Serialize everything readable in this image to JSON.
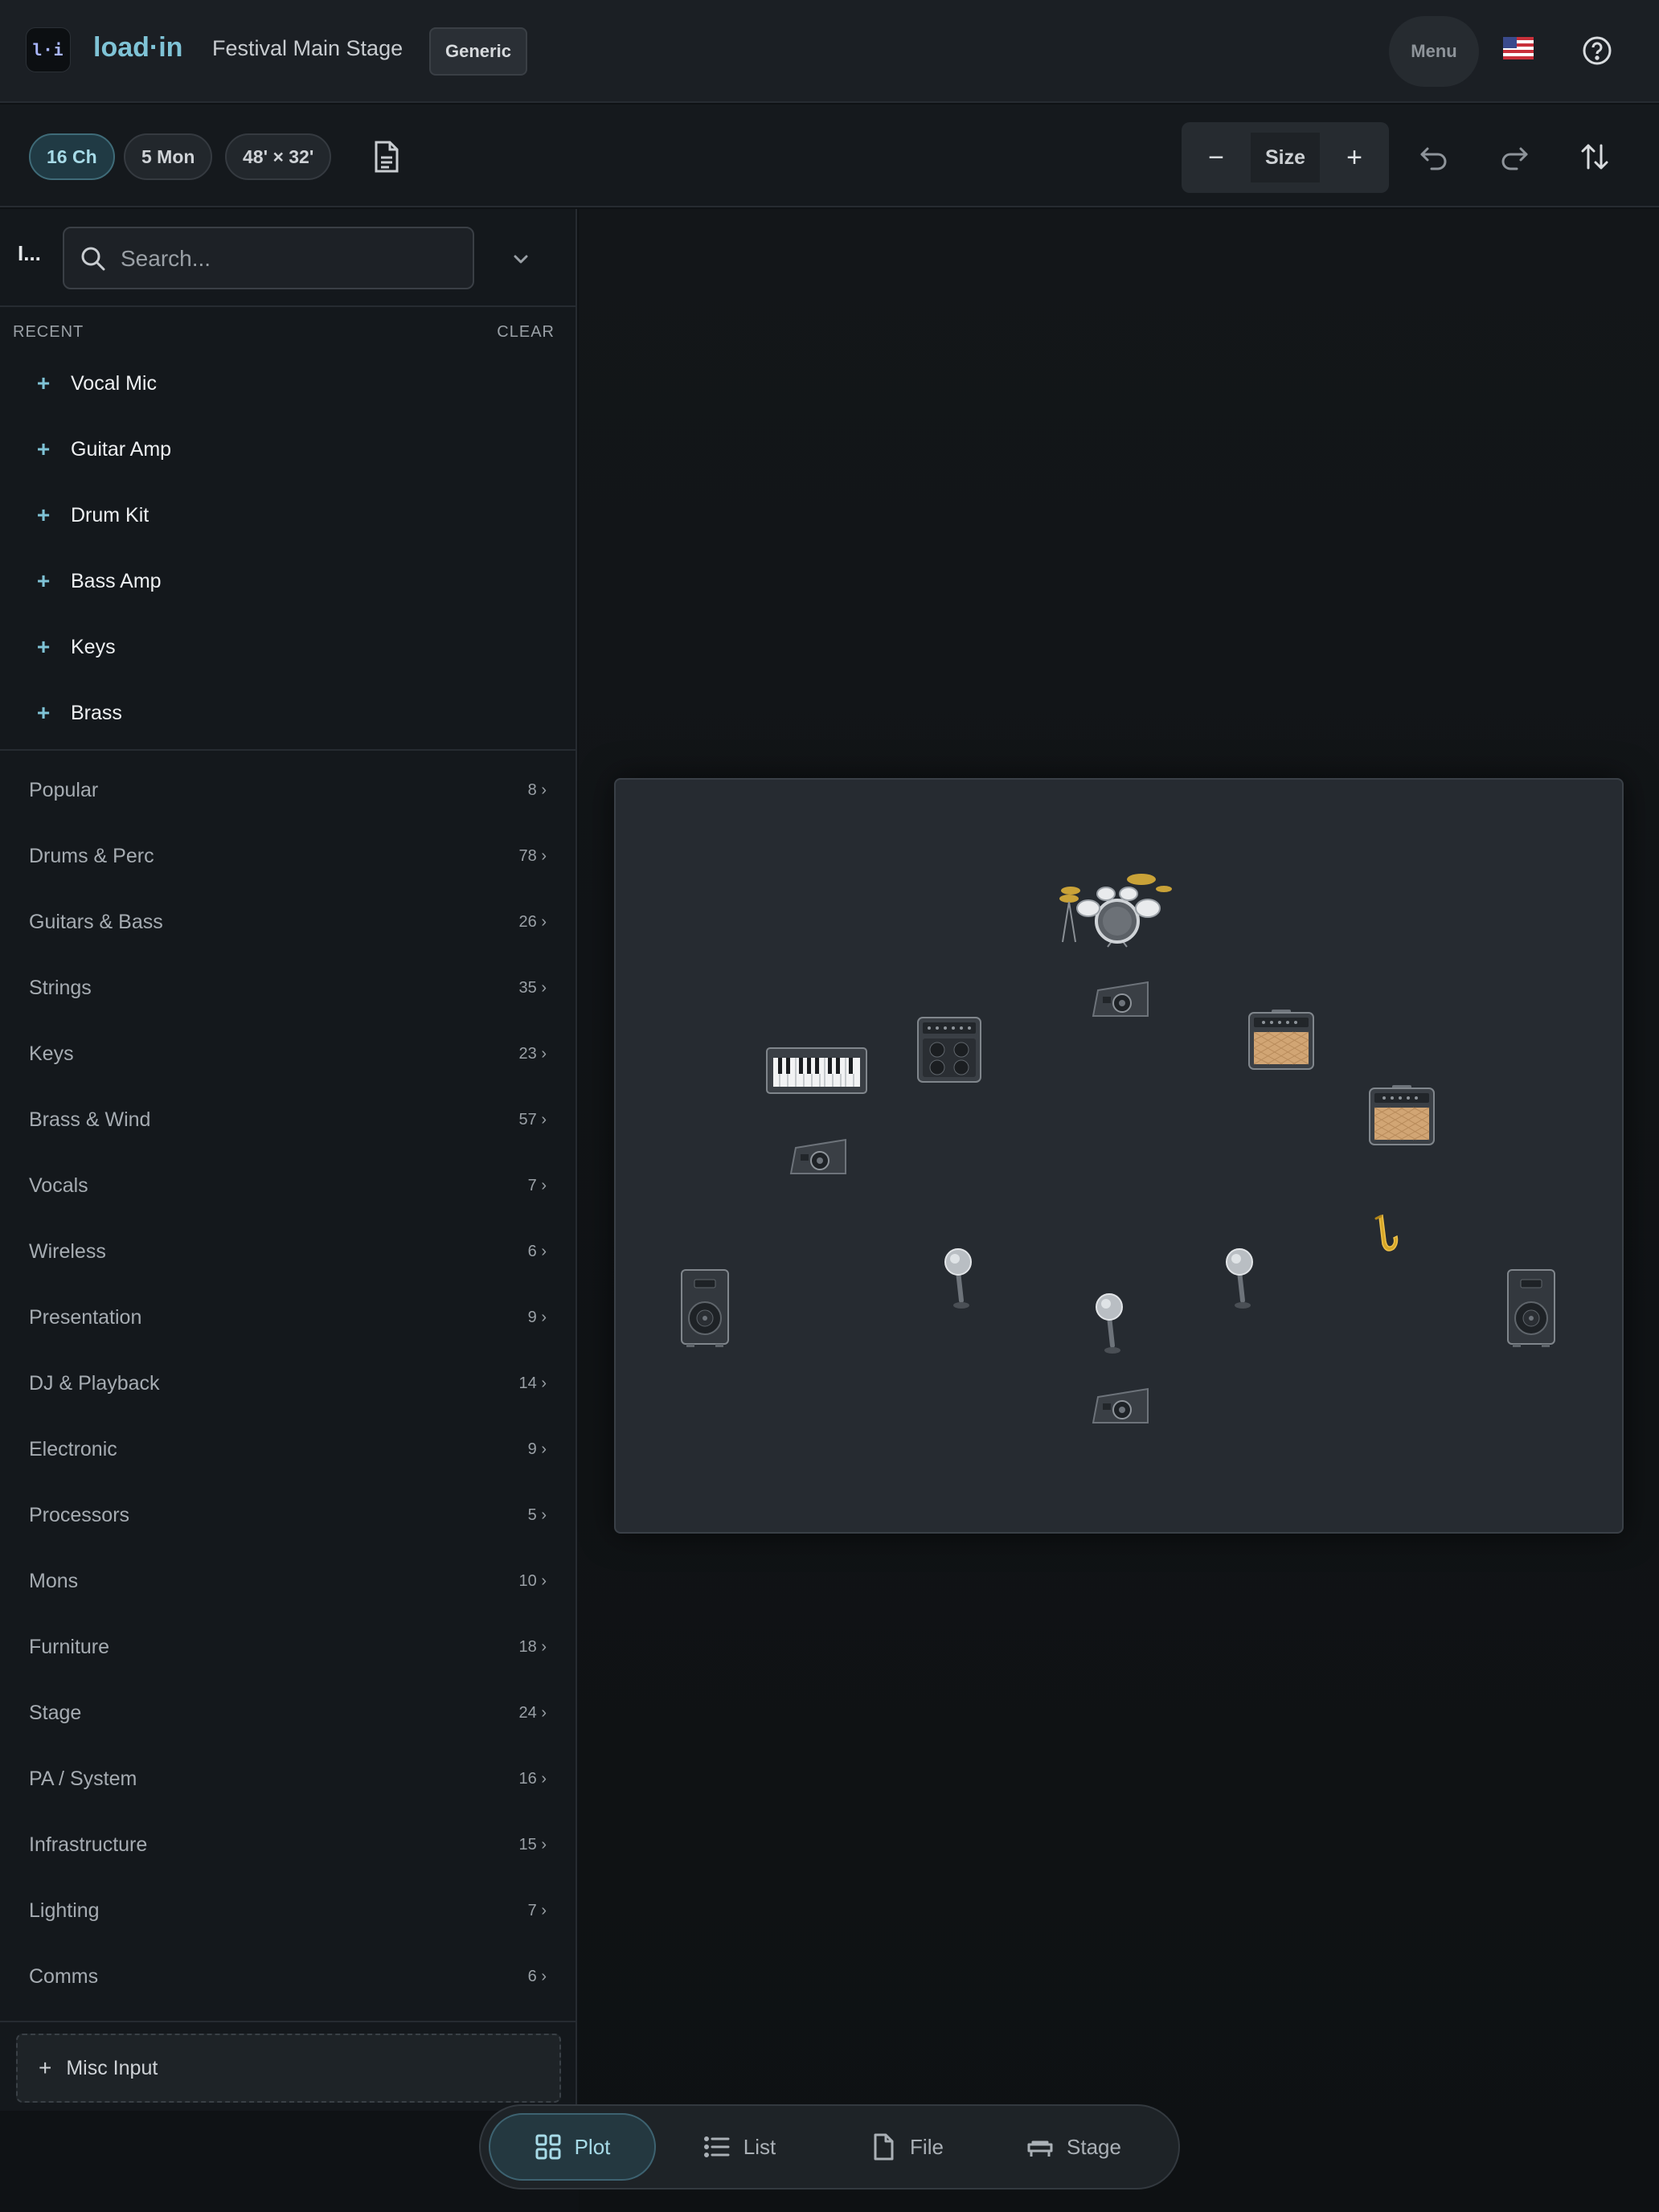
{
  "header": {
    "logo_text": "l·i",
    "brand": "load·in",
    "project_title": "Festival Main Stage",
    "template_badge": "Generic",
    "menu_label": "Menu",
    "flag_icon": "us-flag-icon",
    "help_icon": "help-circle-icon"
  },
  "toolbar": {
    "channels": "16 Ch",
    "monitors": "5 Mon",
    "stage_size": "48' × 32'",
    "notes_icon": "document-icon",
    "size_minus": "−",
    "size_label": "Size",
    "size_plus": "+",
    "undo_icon": "undo-icon",
    "redo_icon": "redo-icon",
    "sort_icon": "swap-vertical-icon"
  },
  "sidebar": {
    "library_label": "I...",
    "search_placeholder": "Search...",
    "recent_heading": "RECENT",
    "clear_label": "CLEAR",
    "recent": [
      {
        "label": "Vocal Mic"
      },
      {
        "label": "Guitar Amp"
      },
      {
        "label": "Drum Kit"
      },
      {
        "label": "Bass Amp"
      },
      {
        "label": "Keys"
      },
      {
        "label": "Brass"
      }
    ],
    "categories": [
      {
        "label": "Popular",
        "count": "8 ›"
      },
      {
        "label": "Drums & Perc",
        "count": "78 ›"
      },
      {
        "label": "Guitars & Bass",
        "count": "26 ›"
      },
      {
        "label": "Strings",
        "count": "35 ›"
      },
      {
        "label": "Keys",
        "count": "23 ›"
      },
      {
        "label": "Brass & Wind",
        "count": "57 ›"
      },
      {
        "label": "Vocals",
        "count": "7 ›"
      },
      {
        "label": "Wireless",
        "count": "6 ›"
      },
      {
        "label": "Presentation",
        "count": "9 ›"
      },
      {
        "label": "DJ & Playback",
        "count": "14 ›"
      },
      {
        "label": "Electronic",
        "count": "9 ›"
      },
      {
        "label": "Processors",
        "count": "5 ›"
      },
      {
        "label": "Mons",
        "count": "10 ›"
      },
      {
        "label": "Furniture",
        "count": "18 ›"
      },
      {
        "label": "Stage",
        "count": "24 ›"
      },
      {
        "label": "PA / System",
        "count": "16 ›"
      },
      {
        "label": "Infrastructure",
        "count": "15 ›"
      },
      {
        "label": "Lighting",
        "count": "7 ›"
      },
      {
        "label": "Comms",
        "count": "6 ›"
      }
    ],
    "misc_input": "Misc Input"
  },
  "stage_items": [
    {
      "name": "drum-kit"
    },
    {
      "name": "monitor-wedge-drums"
    },
    {
      "name": "keyboard"
    },
    {
      "name": "bass-amp"
    },
    {
      "name": "guitar-amp-left"
    },
    {
      "name": "guitar-amp-right"
    },
    {
      "name": "monitor-wedge-keys"
    },
    {
      "name": "saxophone"
    },
    {
      "name": "pa-speaker-left"
    },
    {
      "name": "pa-speaker-right"
    },
    {
      "name": "vocal-mic-left"
    },
    {
      "name": "vocal-mic-center"
    },
    {
      "name": "vocal-mic-right"
    },
    {
      "name": "monitor-wedge-front"
    }
  ],
  "tabs": [
    {
      "label": "Plot",
      "icon": "grid-icon",
      "active": true
    },
    {
      "label": "List",
      "icon": "list-icon",
      "active": false
    },
    {
      "label": "File",
      "icon": "file-icon",
      "active": false
    },
    {
      "label": "Stage",
      "icon": "stage-icon",
      "active": false
    }
  ],
  "colors": {
    "accent": "#7fc3d6",
    "active_tab_bg": "#243840",
    "stage_bg": "#262b31",
    "amp_grille": "#d1a574",
    "sax_gold": "#d6a728"
  }
}
